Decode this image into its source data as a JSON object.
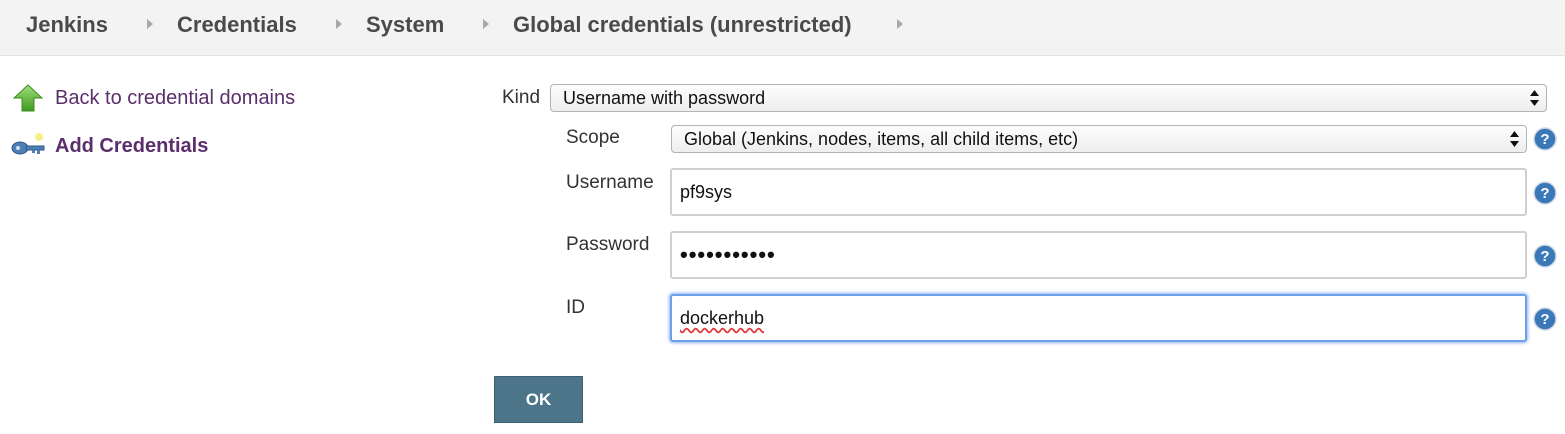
{
  "breadcrumbs": [
    "Jenkins",
    "Credentials",
    "System",
    "Global credentials (unrestricted)"
  ],
  "sidebar": {
    "back_link": "Back to credential domains",
    "add_credentials": "Add Credentials"
  },
  "form": {
    "kind_label": "Kind",
    "kind_value": "Username with password",
    "scope_label": "Scope",
    "scope_value": "Global (Jenkins, nodes, items, all child items, etc)",
    "username_label": "Username",
    "username_value": "pf9sys",
    "password_label": "Password",
    "password_value": "•••••••••••",
    "id_label": "ID",
    "id_value": "dockerhub",
    "ok_label": "OK"
  },
  "colors": {
    "link": "#5b2e6c",
    "ok_button": "#4c7589",
    "help_icon": "#3a78b8",
    "focus_ring": "#6ea0ea"
  },
  "icons": [
    "green-up-arrow-icon",
    "key-icon",
    "help-icon",
    "select-arrows-icon",
    "breadcrumb-chevron-icon"
  ]
}
